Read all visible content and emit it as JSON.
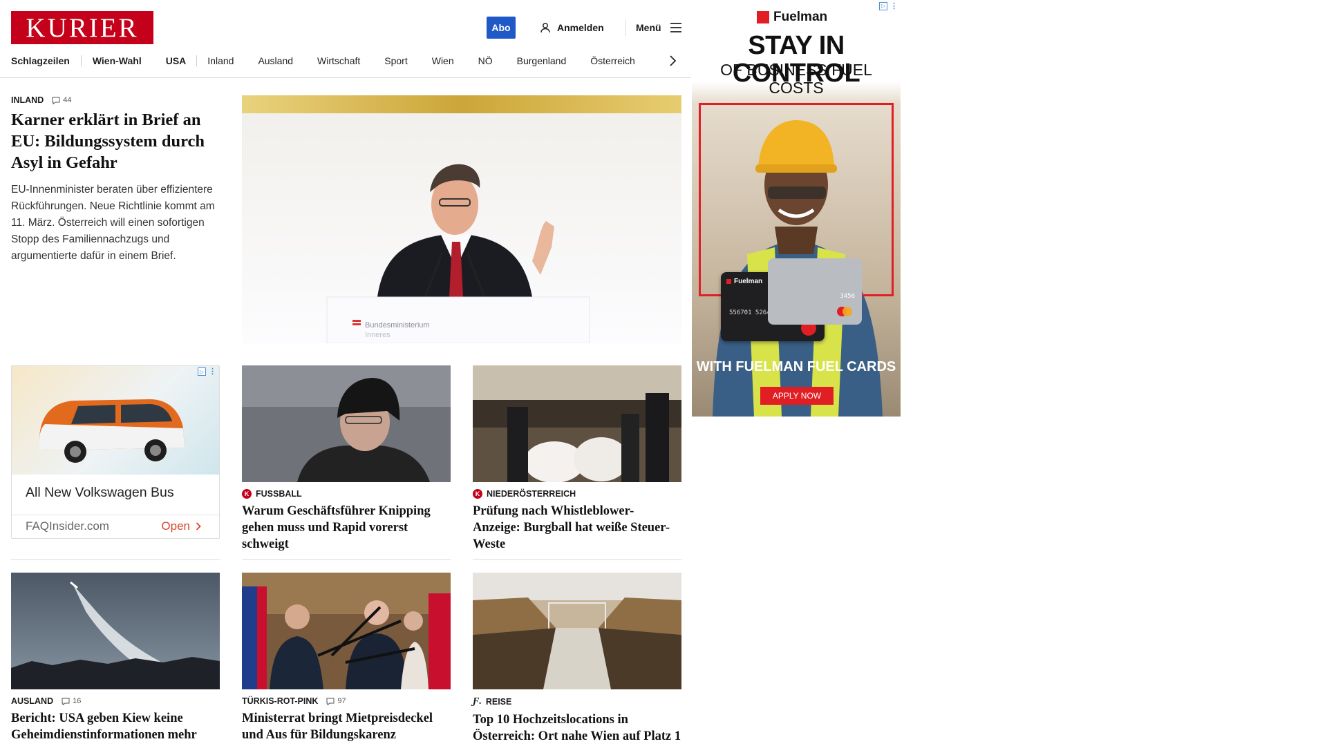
{
  "header": {
    "logo_text": "KURIER",
    "abo_label": "Abo",
    "login_label": "Anmelden",
    "menu_label": "Menü"
  },
  "nav": {
    "items": [
      "Schlagzeilen",
      "Wien-Wahl",
      "USA",
      "Inland",
      "Ausland",
      "Wirtschaft",
      "Sport",
      "Wien",
      "NÖ",
      "Burgenland",
      "Österreich"
    ]
  },
  "lead": {
    "kicker": "INLAND",
    "comments": "44",
    "headline": "Karner erklärt in Brief an EU: Bildungssystem durch Asyl in Gefahr",
    "teaser": "EU-Innenminister beraten über effizientere Rückführungen. Neue Richtlinie kommt am 11. März. Österreich will einen sofortigen Stopp des Familiennachzugs und argumentierte dafür in einem Brief.",
    "image_caption_text": "Bundesministerium",
    "image_caption_text2": "Inneres"
  },
  "native_ad": {
    "title": "All New Volkswagen Bus",
    "domain": "FAQInsider.com",
    "cta": "Open"
  },
  "cards": [
    {
      "kicker": "FUSSBALL",
      "headline": "Warum Geschäftsführer Knipping gehen muss und Rapid vorerst schweigt"
    },
    {
      "kicker": "NIEDERÖSTERREICH",
      "headline": "Prüfung nach Whistleblower-Anzeige: Burgball hat weiße Steuer-Weste"
    },
    {
      "kicker": "AUSLAND",
      "comments": "16",
      "headline": "Bericht: USA geben Kiew keine Geheimdienstinformationen mehr"
    },
    {
      "kicker": "TÜRKIS-ROT-PINK",
      "comments": "97",
      "headline": "Ministerrat bringt Mietpreisdeckel und Aus für Bildungskarenz"
    },
    {
      "kicker": "REISE",
      "headline": "Top 10 Hochzeitslocations in Österreich: Ort nahe Wien auf Platz 1"
    }
  ],
  "banner_ad": {
    "brand": "Fuelman",
    "headline1": "STAY IN CONTROL",
    "headline2": "OF BUSINESS FUEL COSTS",
    "card_brand": "Fuelman",
    "card_number": "556701 52645 485145",
    "card_digits": "3456",
    "bottom_text": "WITH FUELMAN FUEL CARDS",
    "cta": "APPLY NOW"
  },
  "colors": {
    "brand_red": "#c5001a",
    "abo_blue": "#1f59c8",
    "fuelman_red": "#e01e24",
    "ad_cta_orange": "#d9452a"
  }
}
